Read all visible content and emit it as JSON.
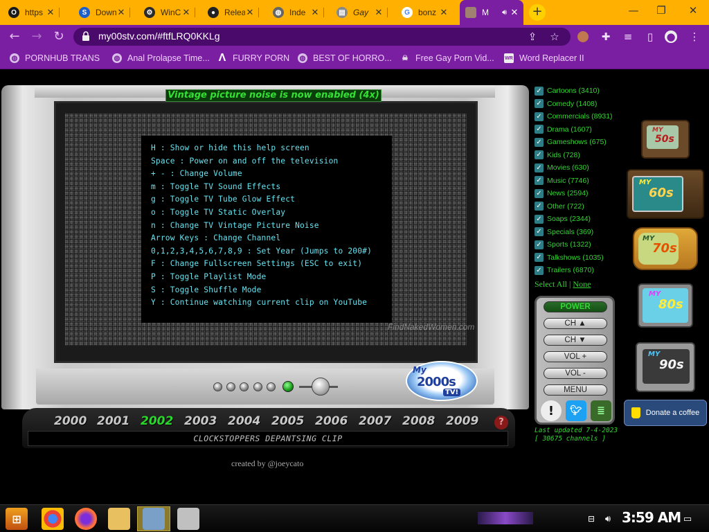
{
  "browser": {
    "tabs": [
      {
        "title": "https",
        "favicon": "opera-icon",
        "fav_color": "#1a1a1a"
      },
      {
        "title": "Down",
        "favicon": "sonic-icon",
        "fav_color": "#1e5fcc"
      },
      {
        "title": "WinC",
        "favicon": "gear-icon",
        "fav_color": "#2a2a2a"
      },
      {
        "title": "Relea",
        "favicon": "github-icon",
        "fav_color": "#222"
      },
      {
        "title": "Inde",
        "favicon": "globe-icon",
        "fav_color": "#666"
      },
      {
        "title": "Gay",
        "favicon": "page-icon",
        "fav_color": "#888"
      },
      {
        "title": "bonz",
        "favicon": "google-icon",
        "fav_color": "#fff"
      },
      {
        "title": "M",
        "favicon": "site-icon",
        "fav_color": "#a08070",
        "active": true
      }
    ],
    "url": "my00stv.com/#ftfLRQ0KKLg",
    "bookmarks": [
      {
        "label": "PORNHUB TRANS",
        "icon": "globe-icon"
      },
      {
        "label": "Anal Prolapse Time...",
        "icon": "globe-icon"
      },
      {
        "label": "FURRY PORN",
        "icon": "lambda-icon"
      },
      {
        "label": "BEST OF HORRO...",
        "icon": "globe-icon"
      },
      {
        "label": "Free Gay Porn Vid...",
        "icon": "skull-icon"
      },
      {
        "label": "Word Replacer II",
        "icon": "wr-icon"
      }
    ]
  },
  "tv": {
    "noise_banner": "Vintage picture noise is now enabled (4x)",
    "help_lines": [
      "H : Show or hide this help screen",
      "Space : Power on and off the television",
      "+ - : Change Volume",
      "m : Toggle TV Sound Effects",
      "g : Toggle TV Tube Glow Effect",
      "o : Toggle TV Static Overlay",
      "n : Change TV Vintage Picture Noise",
      "Arrow Keys : Change Channel",
      "0,1,2,3,4,5,6,7,8,9 : Set Year (Jumps to 200#)",
      "F : Change Fullscreen Settings (ESC to exit)",
      "P : Toggle Playlist Mode",
      "S : Toggle Shuffle Mode",
      "Y : Continue watching current clip on YouTube"
    ],
    "watermark": "FindNakedWomen.com",
    "logo": {
      "my": "My",
      "num": "2000s",
      "tv": "TV!"
    },
    "years": [
      "2000",
      "2001",
      "2002",
      "2003",
      "2004",
      "2005",
      "2006",
      "2007",
      "2008",
      "2009"
    ],
    "active_year": "2002",
    "help_button": "?",
    "now_playing": "CLOCKSTOPPERS DEPANTSING CLIP",
    "credits": "created by @joeycato"
  },
  "channels": [
    {
      "label": "Cartoons (3410)"
    },
    {
      "label": "Comedy (1408)"
    },
    {
      "label": "Commercials (8931)"
    },
    {
      "label": "Drama (1607)"
    },
    {
      "label": "Gameshows (675)"
    },
    {
      "label": "Kids (728)"
    },
    {
      "label": "Movies (630)"
    },
    {
      "label": "Music (7746)"
    },
    {
      "label": "News (2594)"
    },
    {
      "label": "Other (722)"
    },
    {
      "label": "Soaps (2344)"
    },
    {
      "label": "Specials (369)"
    },
    {
      "label": "Sports (1322)"
    },
    {
      "label": "Talkshows (1035)"
    },
    {
      "label": "Trailers (6870)"
    }
  ],
  "select": {
    "all": "Select All",
    "sep": "|",
    "none": "None"
  },
  "remote": {
    "power": "POWER",
    "ch_up": "CH ▲",
    "ch_down": "CH ▼",
    "vol_up": "VOL +",
    "vol_down": "VOL -",
    "menu": "MENU"
  },
  "updated": {
    "line1": "Last updated 7-4-2023",
    "line2": "[ 30675 channels ]"
  },
  "decades": [
    {
      "label": "50s",
      "my": "MY"
    },
    {
      "label": "60s",
      "my": "MY"
    },
    {
      "label": "70s",
      "my": "MY"
    },
    {
      "label": "80s",
      "my": "MY"
    },
    {
      "label": "90s",
      "my": "MY"
    }
  ],
  "donate": "Donate a coffee",
  "taskbar": {
    "clock": "3:59 AM"
  },
  "colors": {
    "accent": "#7b1fa2",
    "tabbar": "#ffb000",
    "channel_green": "#32d632",
    "help_cyan": "#66e3f0"
  }
}
